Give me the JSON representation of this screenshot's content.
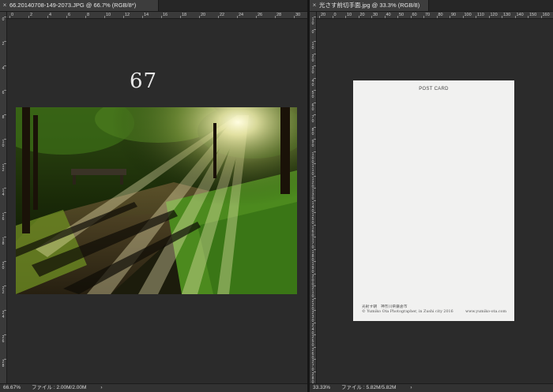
{
  "left_window": {
    "tab_close": "×",
    "tab_title": "66.20140708-149-2073.JPG @ 66.7% (RGB/8*)",
    "big_number": "67",
    "status": {
      "zoom": "66.67%",
      "file_info": "ファイル : 2.00M/2.00M",
      "arrow": "›"
    },
    "ruler_h": [
      "0",
      "2",
      "4",
      "6",
      "8",
      "10",
      "12",
      "14",
      "16",
      "18",
      "20",
      "22",
      "24",
      "26",
      "28",
      "30"
    ],
    "ruler_v": [
      "0",
      "2",
      "4",
      "6",
      "8",
      "10",
      "12",
      "14",
      "16",
      "18",
      "20",
      "22",
      "24",
      "26",
      "28"
    ]
  },
  "right_window": {
    "tab_close": "×",
    "tab_title": "光さす前切手面.jpg @ 33.3% (RGB/8)",
    "status": {
      "zoom": "33.33%",
      "file_info": "ファイル : 5.82M/5.82M",
      "arrow": "›"
    },
    "ruler_h": [
      "20",
      "0",
      "10",
      "20",
      "30",
      "40",
      "50",
      "60",
      "70",
      "80",
      "90",
      "100",
      "110",
      "120",
      "130",
      "140",
      "150",
      "160",
      "170"
    ],
    "ruler_v": [
      "10",
      "0",
      "10",
      "20",
      "30",
      "40",
      "50",
      "60",
      "70",
      "80",
      "90",
      "100",
      "110",
      "120",
      "130",
      "140",
      "150",
      "160",
      "170",
      "180",
      "190",
      "200",
      "210",
      "220",
      "230",
      "240",
      "250",
      "260",
      "270",
      "280"
    ]
  },
  "postcard": {
    "title": "POST CARD",
    "caption_line1": "光射す朝　神奈川県鎌倉市",
    "caption_line2": "© Yumiko Ota Photographer, in Zushi city 2016",
    "url": "www.yumiko-ota.com"
  },
  "colors": {
    "workspace": "#2b2b2b",
    "tab": "#3d3d3d",
    "ruler": "#3a3a3a",
    "postcard": "#f1f1f0"
  }
}
